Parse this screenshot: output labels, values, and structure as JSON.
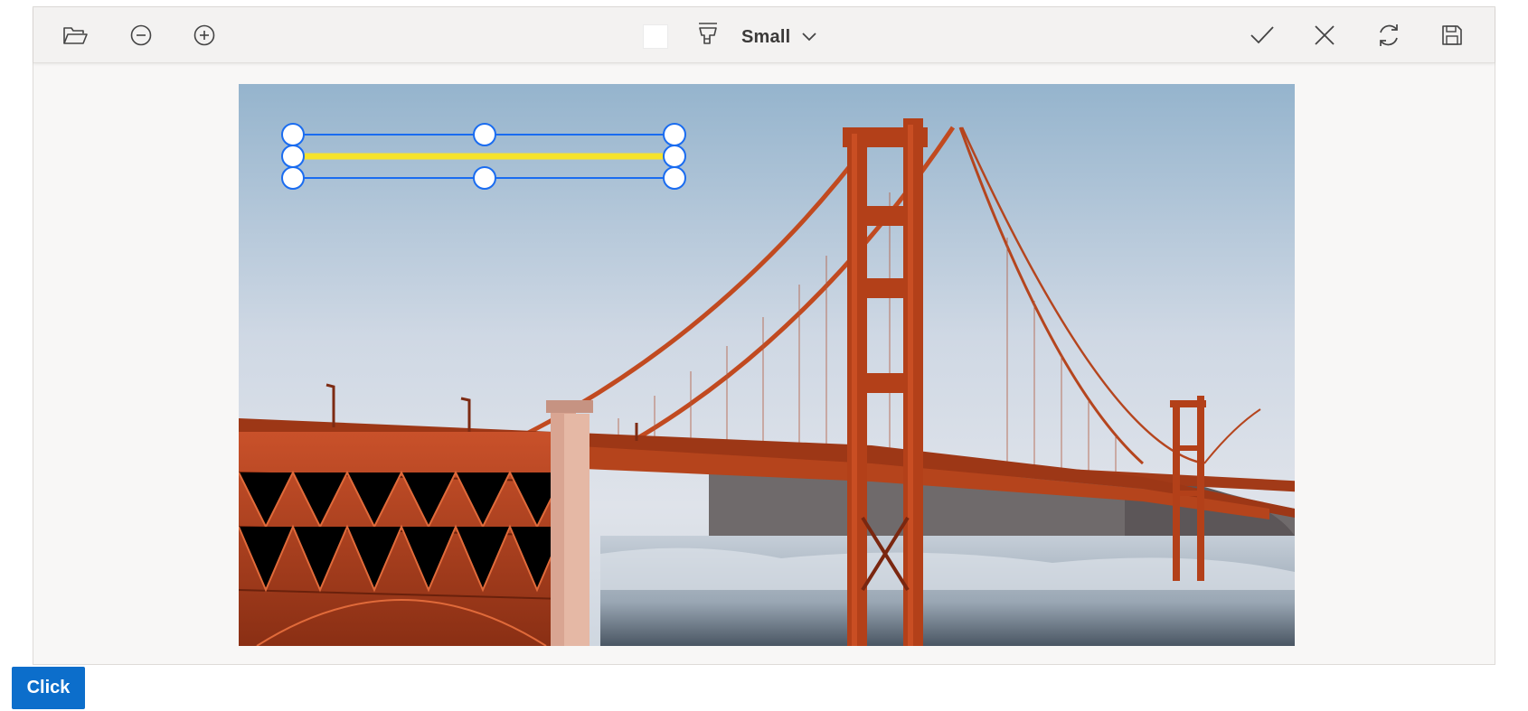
{
  "toolbar": {
    "left_tools": [
      {
        "icon": "open-folder-icon",
        "action": "open"
      },
      {
        "icon": "zoom-out-icon",
        "action": "zoom-out"
      },
      {
        "icon": "zoom-in-icon",
        "action": "zoom-in"
      }
    ],
    "stroke_color": "#ffffff",
    "stroke_width_selected": "Small",
    "right_tools": [
      {
        "icon": "checkmark-icon",
        "action": "apply"
      },
      {
        "icon": "close-icon",
        "action": "cancel"
      },
      {
        "icon": "reset-icon",
        "action": "reset"
      },
      {
        "icon": "save-icon",
        "action": "save"
      }
    ]
  },
  "annotation": {
    "type": "line",
    "stroke_color": "#f5e32c",
    "selection_color": "#1a6cf0"
  },
  "footer": {
    "button_label": "Click"
  },
  "colors": {
    "accent": "#0c6ecb",
    "toolbar_bg": "#f3f2f1",
    "canvas_bg": "#f8f7f6"
  }
}
